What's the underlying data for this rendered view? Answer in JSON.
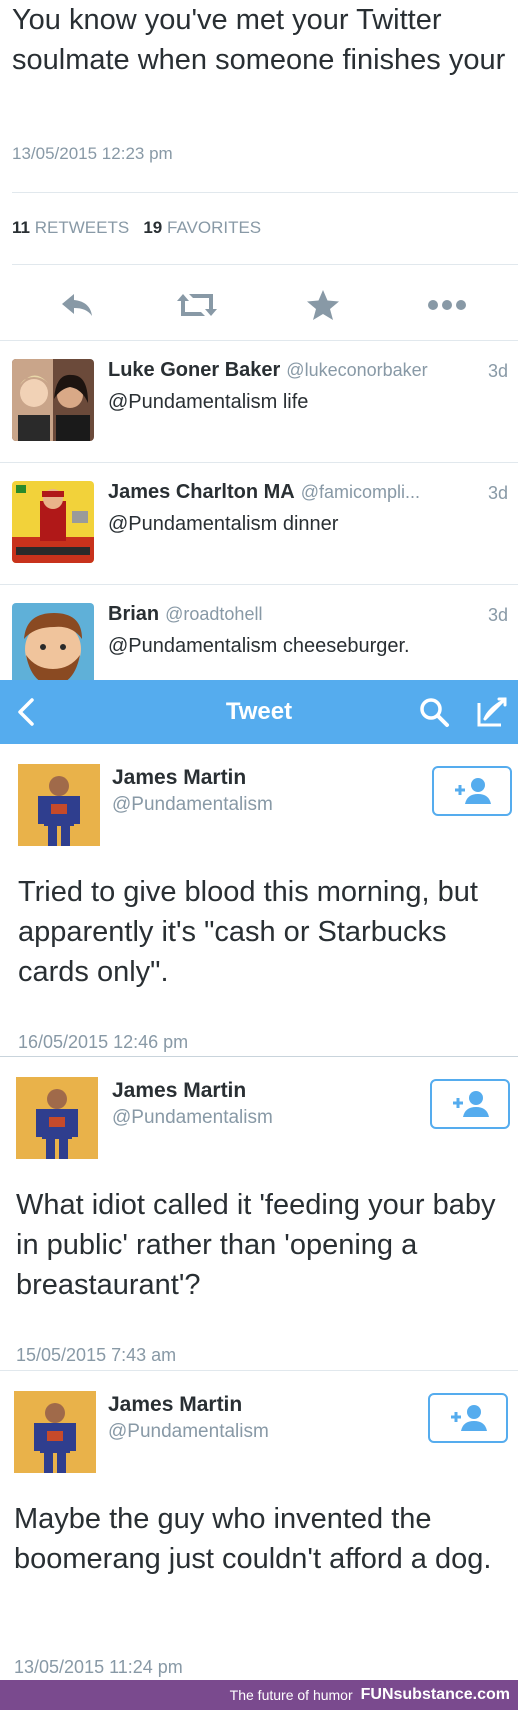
{
  "top_tweet": {
    "text": "You know you've met your Twitter soulmate when someone finishes your",
    "timestamp": "13/05/2015 12:23 pm",
    "retweets_count": "11",
    "retweets_label": "RETWEETS",
    "favorites_count": "19",
    "favorites_label": "FAVORITES",
    "actions": [
      "reply-icon",
      "retweet-icon",
      "favorite-icon",
      "more-icon"
    ]
  },
  "replies": [
    {
      "name": "Luke Goner Baker",
      "handle": "@lukeconorbaker",
      "age": "3d",
      "text": "@Pundamentalism life"
    },
    {
      "name": "James Charlton MA",
      "handle": "@famicompli...",
      "age": "3d",
      "text": "@Pundamentalism dinner"
    },
    {
      "name": "Brian",
      "handle": "@roadtohell",
      "age": "3d",
      "text": "@Pundamentalism cheeseburger."
    }
  ],
  "navbar": {
    "title": "Tweet",
    "color": "#55acee",
    "icons": [
      "back-icon",
      "search-icon",
      "compose-icon"
    ]
  },
  "tweets": [
    {
      "name": "James Martin",
      "handle": "@Pundamentalism",
      "text": "Tried to give blood this morning, but apparently it's \"cash or Starbucks cards only\".",
      "timestamp": "16/05/2015 12:46 pm"
    },
    {
      "name": "James Martin",
      "handle": "@Pundamentalism",
      "text": "What idiot called it 'feeding your baby in public' rather than 'opening a breastaurant'?",
      "timestamp": "15/05/2015 7:43 am"
    },
    {
      "name": "James Martin",
      "handle": "@Pundamentalism",
      "text": "Maybe the guy who invented the boomerang just couldn't afford a dog.",
      "timestamp": "13/05/2015 11:24 pm"
    }
  ],
  "footer": {
    "tagline": "The future of humor",
    "brand": "FUNsubstance.com"
  }
}
